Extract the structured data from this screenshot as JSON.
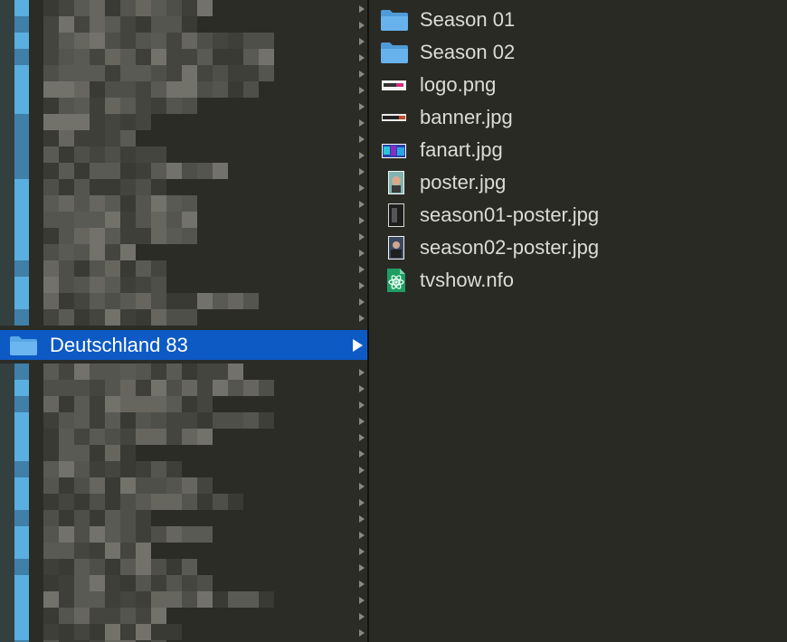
{
  "window": {
    "view": "column-view"
  },
  "left_column": {
    "selected_item": {
      "label": "Deutschland 83",
      "icon": "folder-icon"
    }
  },
  "right_column": {
    "items": [
      {
        "name": "Season 01",
        "icon": "folder-icon"
      },
      {
        "name": "Season 02",
        "icon": "folder-icon"
      },
      {
        "name": "logo.png",
        "icon": "image-logo-icon"
      },
      {
        "name": "banner.jpg",
        "icon": "image-banner-icon"
      },
      {
        "name": "fanart.jpg",
        "icon": "image-fanart-icon"
      },
      {
        "name": "poster.jpg",
        "icon": "image-poster-icon"
      },
      {
        "name": "season01-poster.jpg",
        "icon": "image-poster-icon"
      },
      {
        "name": "season02-poster.jpg",
        "icon": "image-poster-icon"
      },
      {
        "name": "tvshow.nfo",
        "icon": "nfo-file-icon"
      }
    ]
  },
  "colors": {
    "background": "#2a2a25",
    "selection": "#0d5ac5",
    "folder": "#5aa7e6",
    "text": "#dcdcd6"
  }
}
